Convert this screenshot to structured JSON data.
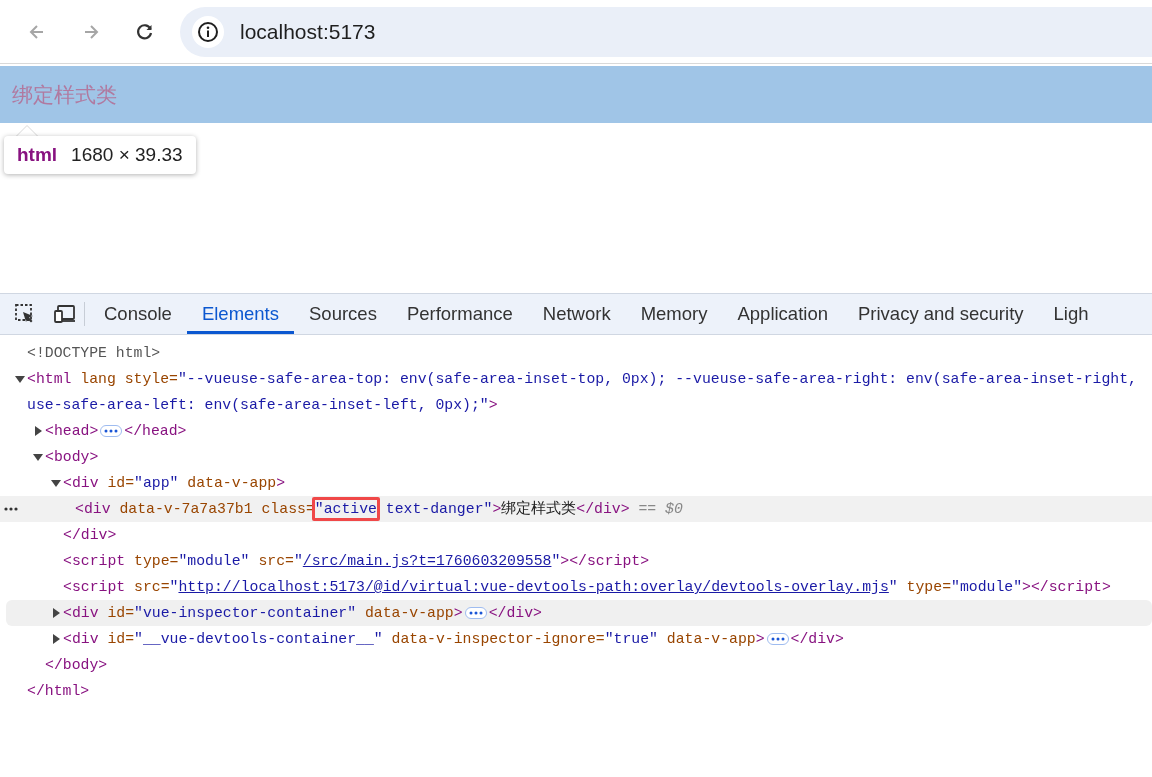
{
  "browser": {
    "nav_buttons": [
      {
        "kind": "back",
        "disabled": true
      },
      {
        "kind": "forward",
        "disabled": true
      },
      {
        "kind": "reload",
        "disabled": false
      }
    ],
    "address": "localhost:5173"
  },
  "page": {
    "heading": "绑定样式类",
    "tooltip": {
      "tag": "html",
      "size": "1680 × 39.33"
    }
  },
  "devtools": {
    "tools": [
      {
        "kind": "inspect"
      },
      {
        "kind": "device"
      }
    ],
    "tabs": [
      {
        "label": "Console",
        "selected": false
      },
      {
        "label": "Elements",
        "selected": true
      },
      {
        "label": "Sources",
        "selected": false
      },
      {
        "label": "Performance",
        "selected": false
      },
      {
        "label": "Network",
        "selected": false
      },
      {
        "label": "Memory",
        "selected": false
      },
      {
        "label": "Application",
        "selected": false
      },
      {
        "label": "Privacy and security",
        "selected": false
      },
      {
        "label": "Ligh",
        "selected": false
      }
    ],
    "tree": [
      {
        "selected": false,
        "hovered": false,
        "open": [
          {
            "kind": "doctype",
            "text": "<!DOCTYPE html>"
          }
        ]
      },
      {
        "selected": false,
        "hovered": false,
        "expanded": true,
        "open": [
          {
            "kind": "tag",
            "text": "<html"
          },
          {
            "kind": "attr",
            "text": " lang"
          },
          {
            "kind": "attr",
            "text": " style="
          },
          {
            "kind": "value",
            "text": "\"--vueuse-safe-area-top: env(safe-area-inset-top, 0px); --vueuse-safe-area-right: env(safe-area-inset-right,"
          }
        ],
        "open_wrap": [
          {
            "kind": "value",
            "text": "use-safe-area-left: env(safe-area-inset-left, 0px);\""
          },
          {
            "kind": "tag",
            "text": ">"
          }
        ],
        "children": [
          {
            "selected": false,
            "hovered": false,
            "expanded": false,
            "open": [
              {
                "kind": "tag",
                "text": "<head>"
              },
              {
                "kind": "badge"
              },
              {
                "kind": "tag",
                "text": "</head>"
              }
            ]
          },
          {
            "selected": false,
            "hovered": false,
            "expanded": true,
            "open": [
              {
                "kind": "tag",
                "text": "<body>"
              }
            ],
            "children": [
              {
                "selected": false,
                "hovered": false,
                "expanded": true,
                "open": [
                  {
                    "kind": "tag",
                    "text": "<div"
                  },
                  {
                    "kind": "attr",
                    "text": " id="
                  },
                  {
                    "kind": "value",
                    "text": "\"app\""
                  },
                  {
                    "kind": "attr",
                    "text": " data-v-app"
                  },
                  {
                    "kind": "tag",
                    "text": ">"
                  }
                ],
                "children": [
                  {
                    "selected": true,
                    "hovered": false,
                    "open": [
                      {
                        "kind": "tag",
                        "text": "<div"
                      },
                      {
                        "kind": "attr",
                        "text": " data-v-7a7a37b1"
                      },
                      {
                        "kind": "attr",
                        "text": " class="
                      },
                      {
                        "kind": "boxed_value",
                        "text": "\"active"
                      },
                      {
                        "kind": "value",
                        "text": " text-danger\""
                      },
                      {
                        "kind": "tag",
                        "text": ">"
                      },
                      {
                        "kind": "text",
                        "text": "绑定样式类"
                      },
                      {
                        "kind": "tag",
                        "text": "</div>"
                      },
                      {
                        "kind": "hint",
                        "text": " == $0"
                      }
                    ]
                  }
                ],
                "close": [
                  {
                    "kind": "tag",
                    "text": "</div>"
                  }
                ]
              },
              {
                "selected": false,
                "hovered": false,
                "open": [
                  {
                    "kind": "tag",
                    "text": "<script"
                  },
                  {
                    "kind": "attr",
                    "text": " type="
                  },
                  {
                    "kind": "value",
                    "text": "\"module\""
                  },
                  {
                    "kind": "attr",
                    "text": " src="
                  },
                  {
                    "kind": "value",
                    "text": "\""
                  },
                  {
                    "kind": "link",
                    "text": "/src/main.js?t=1760603209558"
                  },
                  {
                    "kind": "value",
                    "text": "\""
                  },
                  {
                    "kind": "tag",
                    "text": "></script>"
                  }
                ]
              },
              {
                "selected": false,
                "hovered": false,
                "open": [
                  {
                    "kind": "tag",
                    "text": "<script"
                  },
                  {
                    "kind": "attr",
                    "text": " src="
                  },
                  {
                    "kind": "value",
                    "text": "\""
                  },
                  {
                    "kind": "link",
                    "text": "http://localhost:5173/@id/virtual:vue-devtools-path:overlay/devtools-overlay.mjs"
                  },
                  {
                    "kind": "value",
                    "text": "\""
                  },
                  {
                    "kind": "attr",
                    "text": " type="
                  },
                  {
                    "kind": "value",
                    "text": "\"module\""
                  },
                  {
                    "kind": "tag",
                    "text": "></script>"
                  }
                ]
              },
              {
                "selected": false,
                "hovered": true,
                "expanded": false,
                "open": [
                  {
                    "kind": "tag",
                    "text": "<div"
                  },
                  {
                    "kind": "attr",
                    "text": " id="
                  },
                  {
                    "kind": "value",
                    "text": "\"vue-inspector-container\""
                  },
                  {
                    "kind": "attr",
                    "text": " data-v-app"
                  },
                  {
                    "kind": "tag",
                    "text": ">"
                  },
                  {
                    "kind": "badge"
                  },
                  {
                    "kind": "tag",
                    "text": "</div>"
                  }
                ]
              },
              {
                "selected": false,
                "hovered": false,
                "expanded": false,
                "open": [
                  {
                    "kind": "tag",
                    "text": "<div"
                  },
                  {
                    "kind": "attr",
                    "text": " id="
                  },
                  {
                    "kind": "value",
                    "text": "\"__vue-devtools-container__\""
                  },
                  {
                    "kind": "attr",
                    "text": " data-v-inspector-ignore="
                  },
                  {
                    "kind": "value",
                    "text": "\"true\""
                  },
                  {
                    "kind": "attr",
                    "text": " data-v-app"
                  },
                  {
                    "kind": "tag",
                    "text": ">"
                  },
                  {
                    "kind": "badge"
                  },
                  {
                    "kind": "tag",
                    "text": "</div>"
                  }
                ]
              }
            ],
            "close": [
              {
                "kind": "tag",
                "text": "</body>"
              }
            ]
          }
        ],
        "close": [
          {
            "kind": "tag",
            "text": "</html>"
          }
        ]
      }
    ]
  }
}
